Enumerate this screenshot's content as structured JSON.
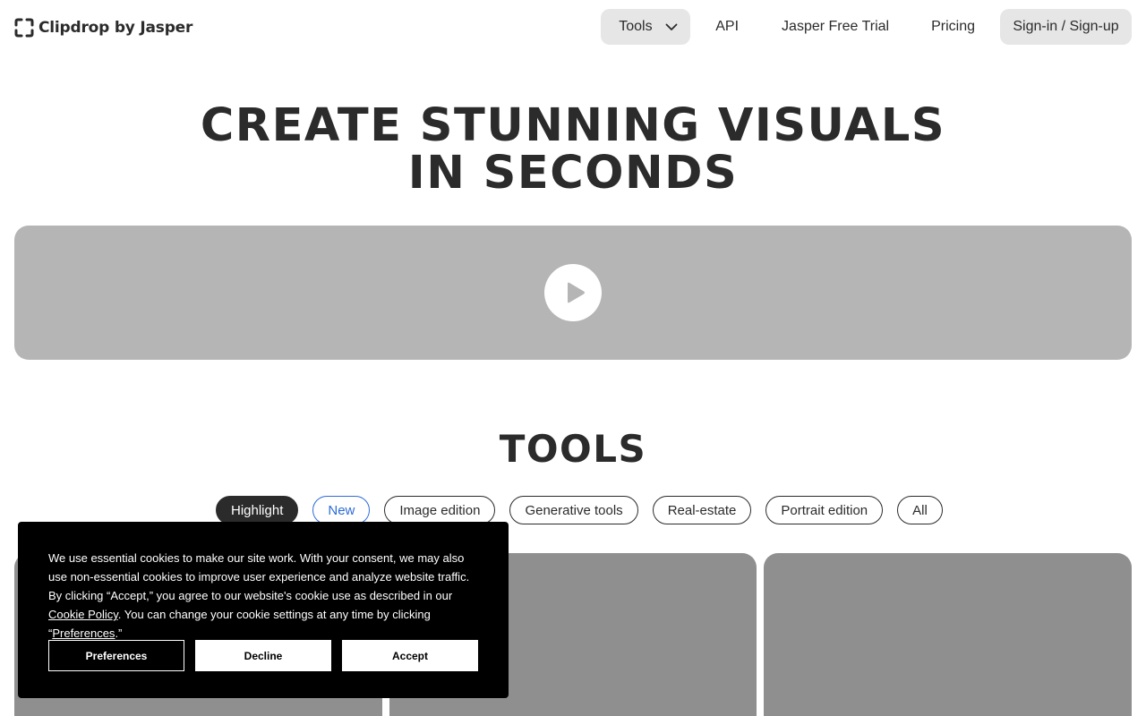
{
  "header": {
    "logo_text": "Clipdrop by Jasper",
    "nav": {
      "tools_label": "Tools",
      "api_label": "API",
      "trial_label": "Jasper Free Trial",
      "pricing_label": "Pricing",
      "signin_label": "Sign-in / Sign-up"
    }
  },
  "hero": {
    "title_line1": "CREATE STUNNING VISUALS",
    "title_line2": "IN SECONDS",
    "video_icon": "play-icon"
  },
  "tools": {
    "title": "TOOLS",
    "filters": [
      "Highlight",
      "New",
      "Image edition",
      "Generative tools",
      "Real-estate",
      "Portrait edition",
      "All"
    ],
    "active_filter": "Highlight"
  },
  "cookie_banner": {
    "text_part1": "We use essential cookies to make our site work. With your consent, we may also use non-essential cookies to improve user experience and analyze website traffic. By clicking “Accept,” you agree to our website's cookie use as described in our ",
    "policy_link": "Cookie Policy",
    "text_part2": ". You can change your cookie settings at any time by clicking “",
    "preferences_link": "Preferences",
    "text_part3": ".”",
    "preferences_button": "Preferences",
    "decline_button": "Decline",
    "accept_button": "Accept"
  },
  "colors": {
    "text": "#2b2b2b",
    "nav_pill_bg": "#e6e6e6",
    "video_bg": "#b5b5b5",
    "card_bg": "#8f8f8f",
    "new_chip_accent": "#2d6bd9",
    "cookie_bg": "#000000"
  }
}
